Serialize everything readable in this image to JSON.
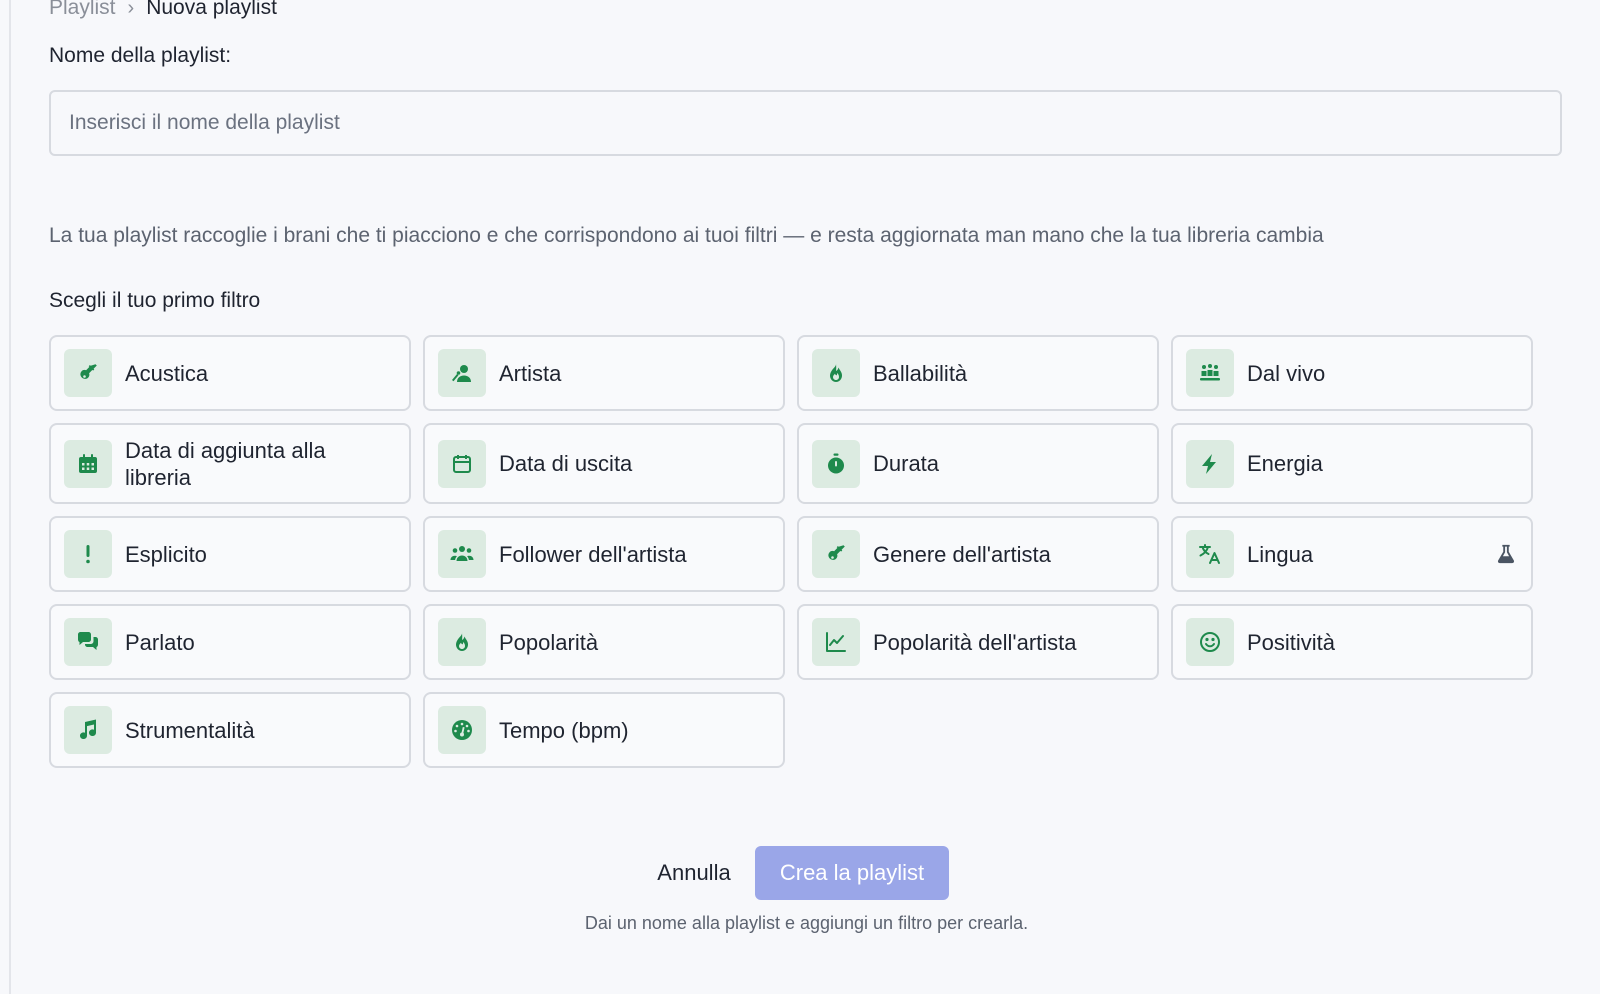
{
  "breadcrumb": {
    "root": "Playlist",
    "separator": "›",
    "current": "Nuova playlist"
  },
  "form": {
    "name_label": "Nome della playlist:",
    "name_placeholder": "Inserisci il nome della playlist",
    "name_value": ""
  },
  "description": "La tua playlist raccoglie i brani che ti piacciono e che corrispondono ai tuoi filtri — e resta aggiornata man mano che la tua libreria cambia",
  "filters": {
    "title": "Scegli il tuo primo filtro",
    "items": [
      {
        "label": "Acustica",
        "icon": "guitar-icon"
      },
      {
        "label": "Artista",
        "icon": "artist-icon"
      },
      {
        "label": "Ballabilità",
        "icon": "fire-icon"
      },
      {
        "label": "Dal vivo",
        "icon": "audience-icon"
      },
      {
        "label": "Data di aggiunta alla libreria",
        "icon": "calendar-filled-icon"
      },
      {
        "label": "Data di uscita",
        "icon": "calendar-outline-icon"
      },
      {
        "label": "Durata",
        "icon": "stopwatch-icon"
      },
      {
        "label": "Energia",
        "icon": "bolt-icon"
      },
      {
        "label": "Esplicito",
        "icon": "exclamation-icon"
      },
      {
        "label": "Follower dell'artista",
        "icon": "users-icon"
      },
      {
        "label": "Genere dell'artista",
        "icon": "guitar-icon"
      },
      {
        "label": "Lingua",
        "icon": "translate-icon",
        "badge_icon": "flask-icon"
      },
      {
        "label": "Parlato",
        "icon": "chat-icon"
      },
      {
        "label": "Popolarità",
        "icon": "fire-icon"
      },
      {
        "label": "Popolarità dell'artista",
        "icon": "chart-line-icon"
      },
      {
        "label": "Positività",
        "icon": "smile-icon"
      },
      {
        "label": "Strumentalità",
        "icon": "music-note-icon"
      },
      {
        "label": "Tempo (bpm)",
        "icon": "gauge-icon"
      }
    ]
  },
  "actions": {
    "cancel_label": "Annulla",
    "create_label": "Crea la playlist",
    "hint": "Dai un nome alla playlist e aggiungi un filtro per crearla."
  },
  "colors": {
    "accent_green": "#1e8a4c",
    "icon_tile_bg": "#dcebe1",
    "primary_disabled": "#9aa6e8"
  }
}
